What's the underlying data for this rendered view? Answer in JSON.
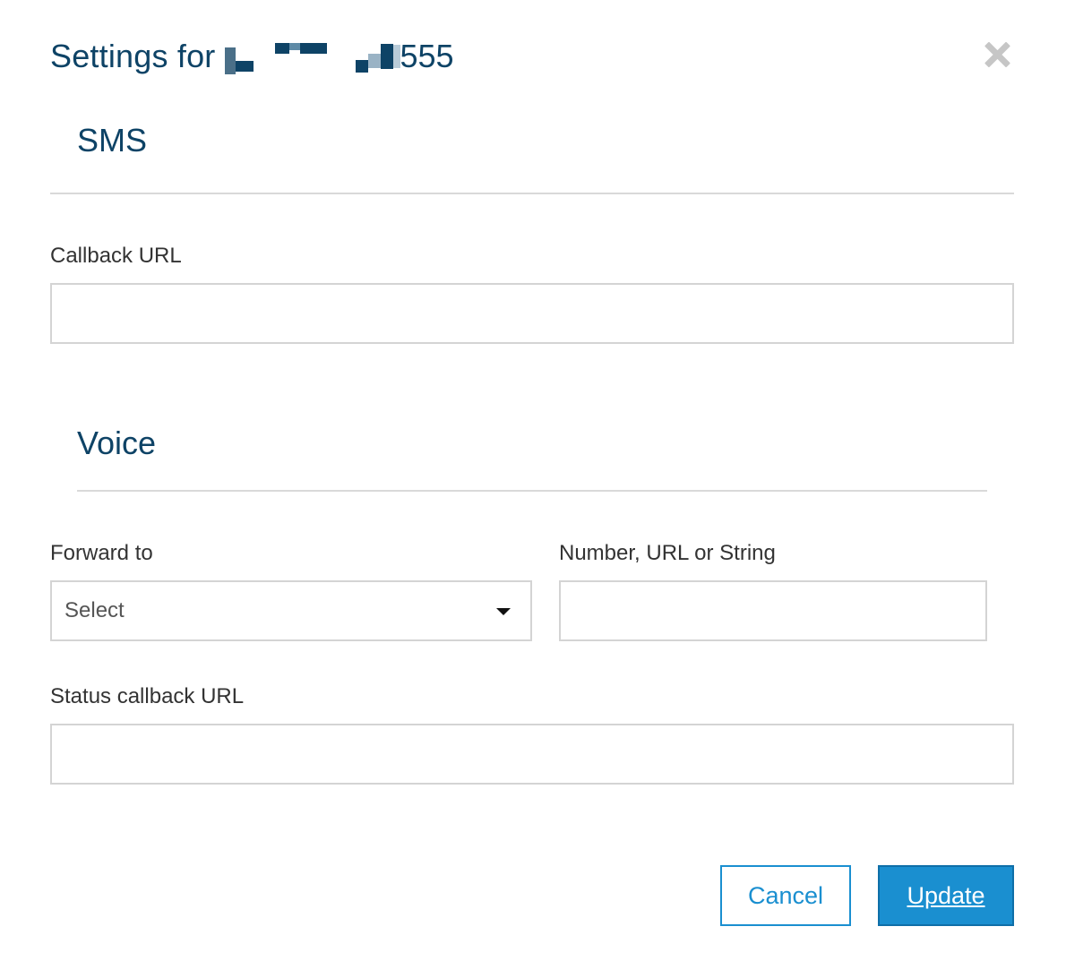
{
  "dialog": {
    "title_prefix": "Settings for",
    "title_number_visible_suffix": "555",
    "close_icon": "close-icon"
  },
  "sms": {
    "heading": "SMS",
    "callback_url_label": "Callback URL",
    "callback_url_value": ""
  },
  "voice": {
    "heading": "Voice",
    "forward_to_label": "Forward to",
    "forward_to_selected": "Select",
    "target_label": "Number, URL or String",
    "target_value": "",
    "status_callback_label": "Status callback URL",
    "status_callback_value": ""
  },
  "actions": {
    "cancel_label": "Cancel",
    "update_label": "Update"
  },
  "colors": {
    "heading": "#0e4366",
    "accent": "#1a8fd0",
    "border": "#d4d4d4",
    "close_icon": "#c6c6c6"
  }
}
